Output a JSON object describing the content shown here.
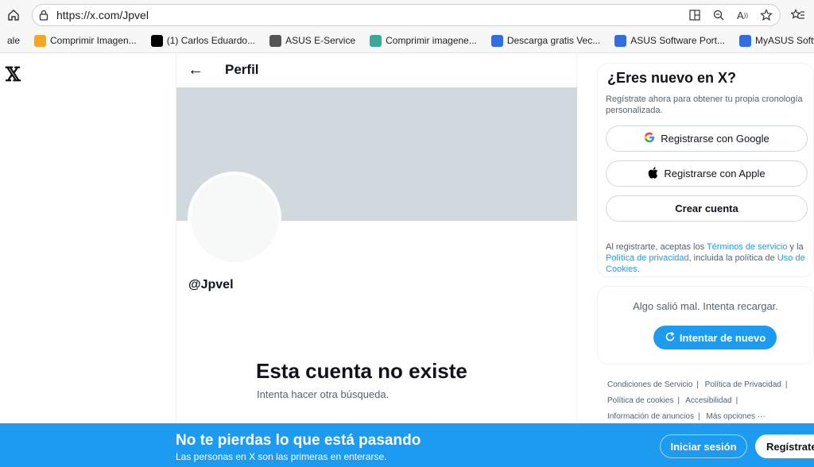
{
  "browser": {
    "url": "https://x.com/Jpvel",
    "bookmarks": [
      {
        "label": "ale",
        "color": "#ffffff"
      },
      {
        "label": "Comprimir Imagen...",
        "color": "#f5a623"
      },
      {
        "label": "(1) Carlos Eduardo...",
        "color": "#000000"
      },
      {
        "label": "ASUS E-Service",
        "color": "#555555"
      },
      {
        "label": "Comprimir imagene...",
        "color": "#3aa89b"
      },
      {
        "label": "Descarga gratis Vec...",
        "color": "#2f6de1"
      },
      {
        "label": "ASUS Software Port...",
        "color": "#2f6de1"
      },
      {
        "label": "MyASUS Software -...",
        "color": "#2f6de1"
      }
    ]
  },
  "main": {
    "header_title": "Perfil",
    "handle": "@Jpvel",
    "empty_title": "Esta cuenta no existe",
    "empty_sub": "Intenta hacer otra búsqueda."
  },
  "signup_card": {
    "title": "¿Eres nuevo en X?",
    "subtitle": "Regístrate ahora para obtener tu propia cronología personalizada.",
    "google_label": "Registrarse con Google",
    "apple_label": "Registrarse con Apple",
    "create_label": "Crear cuenta",
    "terms_pre": "Al registrarte, aceptas los ",
    "terms_link": "Términos de servicio",
    "terms_mid1": " y la ",
    "privacy_link": "Política de privacidad",
    "terms_mid2": ", incluida la política de ",
    "cookies_link": "Uso de Cookies",
    "terms_end": "."
  },
  "error_card": {
    "message": "Algo salió mal. Intenta recargar.",
    "retry_label": "Intentar de nuevo"
  },
  "footer": {
    "links": [
      "Condiciones de Servicio",
      "Política de Privacidad",
      "Política de cookies",
      "Accesibilidad",
      "Información de anuncios",
      "Más opciones ···"
    ]
  },
  "bottom_bar": {
    "title": "No te pierdas lo que está pasando",
    "subtitle": "Las personas en X son las primeras en enterarse.",
    "login_label": "Iniciar sesión",
    "signup_label": "Regístrate"
  },
  "colors": {
    "accent": "#1d9bf0",
    "banner": "#cfd9de"
  }
}
